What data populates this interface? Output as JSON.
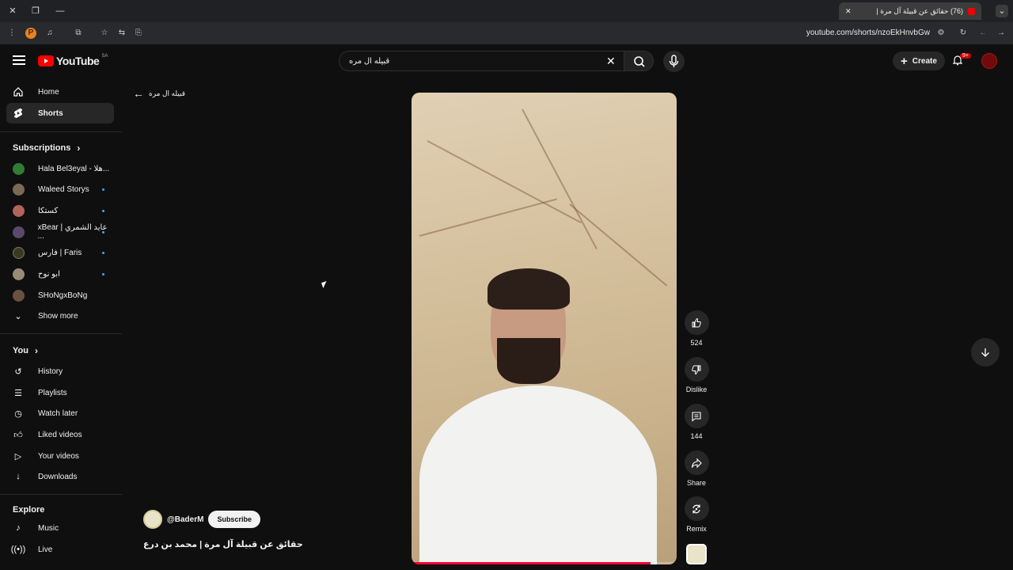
{
  "browser": {
    "tab_title": "(76) حقائق عن قبيلة آل مرة |",
    "url": "youtube.com/shorts/nzoEkHnvbGw"
  },
  "masthead": {
    "logo_text": "YouTube",
    "country_code": "SA",
    "search_value": "قبيله ال مره",
    "create_label": "Create",
    "notification_badge": "9+"
  },
  "sidebar": {
    "main": [
      {
        "label": "Home",
        "icon": "home-icon"
      },
      {
        "label": "Shorts",
        "icon": "shorts-icon",
        "active": true
      }
    ],
    "subscriptions_header": "Subscriptions",
    "subscriptions": [
      {
        "label": "Hala Bel3eyal - هلا...",
        "color": "#2e7d32"
      },
      {
        "label": "Waleed Storys",
        "color": "#7a6a55"
      },
      {
        "label": "كستكا",
        "color": "#b0645a"
      },
      {
        "label": "xBear | عايد الشمري ...",
        "color": "#5a4a6a"
      },
      {
        "label": "فارس | Faris",
        "color": "#3a3a22"
      },
      {
        "label": "ابو نوح",
        "color": "#9a8a7a"
      },
      {
        "label": "SHoNgxBoNg",
        "color": "#6a5040"
      }
    ],
    "show_more": "Show more",
    "you_header": "You",
    "you": [
      {
        "label": "History",
        "icon": "history-icon"
      },
      {
        "label": "Playlists",
        "icon": "playlists-icon"
      },
      {
        "label": "Watch later",
        "icon": "watch-later-icon"
      },
      {
        "label": "Liked videos",
        "icon": "like-icon"
      },
      {
        "label": "Your videos",
        "icon": "your-videos-icon"
      },
      {
        "label": "Downloads",
        "icon": "download-icon"
      }
    ],
    "explore_header": "Explore",
    "explore": [
      {
        "label": "Music",
        "icon": "music-icon"
      },
      {
        "label": "Live",
        "icon": "live-icon"
      }
    ]
  },
  "shorts": {
    "back_label": "قبيله ال مره",
    "channel": "@BaderM",
    "subscribe_label": "Subscribe",
    "title": "حقائق عن قبيلة آل مرة | محمد بن درع",
    "likes": "524",
    "dislike_label": "Dislike",
    "comments": "144",
    "share_label": "Share",
    "remix_label": "Remix",
    "progress_fraction": 0.9
  }
}
